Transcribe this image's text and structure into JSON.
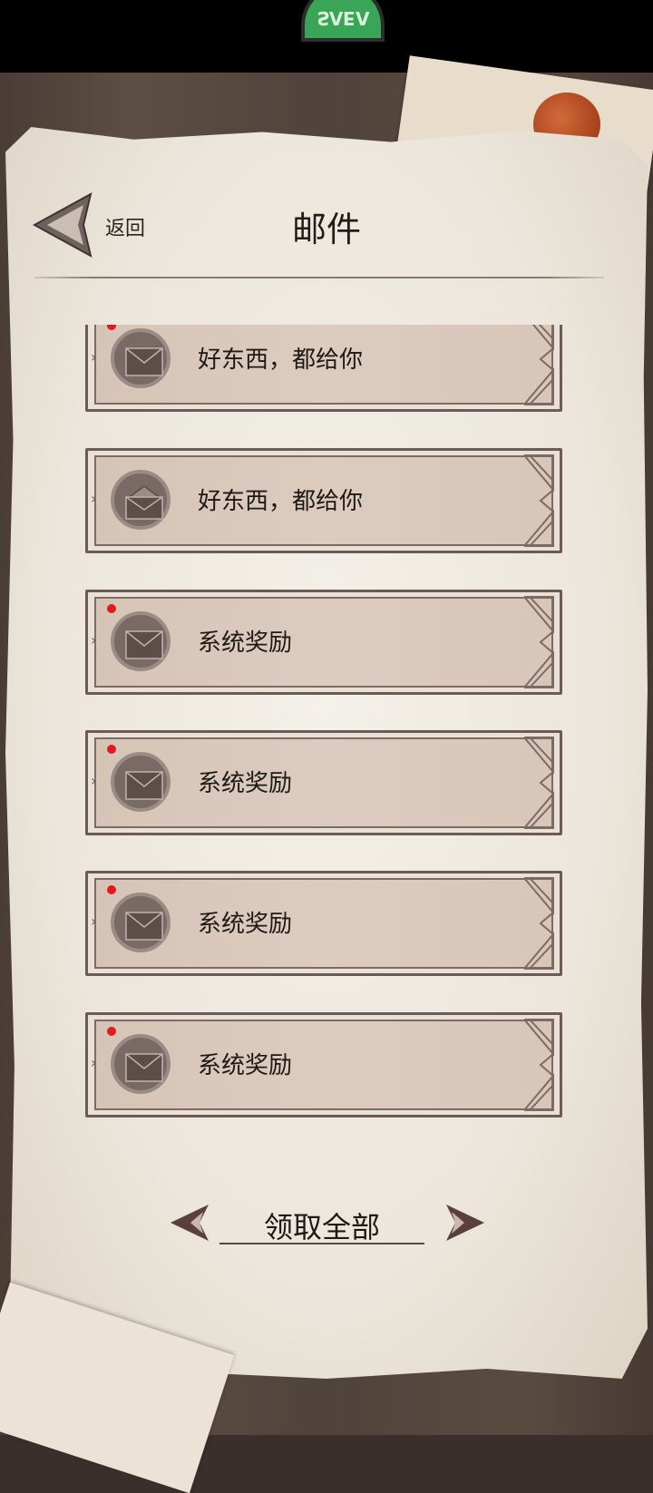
{
  "status_badge": "ɅƎɅƧ",
  "header": {
    "back_label": "返回",
    "title": "邮件"
  },
  "mails": [
    {
      "subject": "好东西，都给你",
      "unread": true,
      "opened": false
    },
    {
      "subject": "好东西，都给你",
      "unread": false,
      "opened": true
    },
    {
      "subject": "系统奖励",
      "unread": true,
      "opened": false
    },
    {
      "subject": "系统奖励",
      "unread": true,
      "opened": false
    },
    {
      "subject": "系统奖励",
      "unread": true,
      "opened": false
    },
    {
      "subject": "系统奖励",
      "unread": true,
      "opened": false
    }
  ],
  "footer": {
    "claim_all_label": "领取全部"
  },
  "colors": {
    "unread_dot": "#e11b1b",
    "badge_green": "#3aa557",
    "frame": "#6d5a55"
  }
}
